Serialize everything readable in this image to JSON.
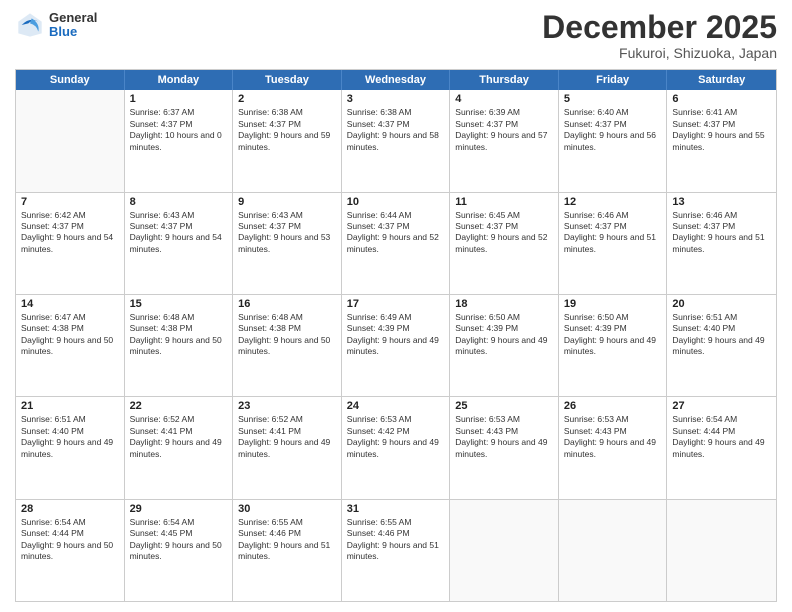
{
  "header": {
    "logo": {
      "general": "General",
      "blue": "Blue"
    },
    "title": "December 2025",
    "subtitle": "Fukuroi, Shizuoka, Japan"
  },
  "calendar": {
    "days": [
      "Sunday",
      "Monday",
      "Tuesday",
      "Wednesday",
      "Thursday",
      "Friday",
      "Saturday"
    ],
    "rows": [
      [
        {
          "day": "",
          "empty": true
        },
        {
          "day": "1",
          "sunrise": "Sunrise: 6:37 AM",
          "sunset": "Sunset: 4:37 PM",
          "daylight": "Daylight: 10 hours and 0 minutes."
        },
        {
          "day": "2",
          "sunrise": "Sunrise: 6:38 AM",
          "sunset": "Sunset: 4:37 PM",
          "daylight": "Daylight: 9 hours and 59 minutes."
        },
        {
          "day": "3",
          "sunrise": "Sunrise: 6:38 AM",
          "sunset": "Sunset: 4:37 PM",
          "daylight": "Daylight: 9 hours and 58 minutes."
        },
        {
          "day": "4",
          "sunrise": "Sunrise: 6:39 AM",
          "sunset": "Sunset: 4:37 PM",
          "daylight": "Daylight: 9 hours and 57 minutes."
        },
        {
          "day": "5",
          "sunrise": "Sunrise: 6:40 AM",
          "sunset": "Sunset: 4:37 PM",
          "daylight": "Daylight: 9 hours and 56 minutes."
        },
        {
          "day": "6",
          "sunrise": "Sunrise: 6:41 AM",
          "sunset": "Sunset: 4:37 PM",
          "daylight": "Daylight: 9 hours and 55 minutes."
        }
      ],
      [
        {
          "day": "7",
          "sunrise": "Sunrise: 6:42 AM",
          "sunset": "Sunset: 4:37 PM",
          "daylight": "Daylight: 9 hours and 54 minutes."
        },
        {
          "day": "8",
          "sunrise": "Sunrise: 6:43 AM",
          "sunset": "Sunset: 4:37 PM",
          "daylight": "Daylight: 9 hours and 54 minutes."
        },
        {
          "day": "9",
          "sunrise": "Sunrise: 6:43 AM",
          "sunset": "Sunset: 4:37 PM",
          "daylight": "Daylight: 9 hours and 53 minutes."
        },
        {
          "day": "10",
          "sunrise": "Sunrise: 6:44 AM",
          "sunset": "Sunset: 4:37 PM",
          "daylight": "Daylight: 9 hours and 52 minutes."
        },
        {
          "day": "11",
          "sunrise": "Sunrise: 6:45 AM",
          "sunset": "Sunset: 4:37 PM",
          "daylight": "Daylight: 9 hours and 52 minutes."
        },
        {
          "day": "12",
          "sunrise": "Sunrise: 6:46 AM",
          "sunset": "Sunset: 4:37 PM",
          "daylight": "Daylight: 9 hours and 51 minutes."
        },
        {
          "day": "13",
          "sunrise": "Sunrise: 6:46 AM",
          "sunset": "Sunset: 4:37 PM",
          "daylight": "Daylight: 9 hours and 51 minutes."
        }
      ],
      [
        {
          "day": "14",
          "sunrise": "Sunrise: 6:47 AM",
          "sunset": "Sunset: 4:38 PM",
          "daylight": "Daylight: 9 hours and 50 minutes."
        },
        {
          "day": "15",
          "sunrise": "Sunrise: 6:48 AM",
          "sunset": "Sunset: 4:38 PM",
          "daylight": "Daylight: 9 hours and 50 minutes."
        },
        {
          "day": "16",
          "sunrise": "Sunrise: 6:48 AM",
          "sunset": "Sunset: 4:38 PM",
          "daylight": "Daylight: 9 hours and 50 minutes."
        },
        {
          "day": "17",
          "sunrise": "Sunrise: 6:49 AM",
          "sunset": "Sunset: 4:39 PM",
          "daylight": "Daylight: 9 hours and 49 minutes."
        },
        {
          "day": "18",
          "sunrise": "Sunrise: 6:50 AM",
          "sunset": "Sunset: 4:39 PM",
          "daylight": "Daylight: 9 hours and 49 minutes."
        },
        {
          "day": "19",
          "sunrise": "Sunrise: 6:50 AM",
          "sunset": "Sunset: 4:39 PM",
          "daylight": "Daylight: 9 hours and 49 minutes."
        },
        {
          "day": "20",
          "sunrise": "Sunrise: 6:51 AM",
          "sunset": "Sunset: 4:40 PM",
          "daylight": "Daylight: 9 hours and 49 minutes."
        }
      ],
      [
        {
          "day": "21",
          "sunrise": "Sunrise: 6:51 AM",
          "sunset": "Sunset: 4:40 PM",
          "daylight": "Daylight: 9 hours and 49 minutes."
        },
        {
          "day": "22",
          "sunrise": "Sunrise: 6:52 AM",
          "sunset": "Sunset: 4:41 PM",
          "daylight": "Daylight: 9 hours and 49 minutes."
        },
        {
          "day": "23",
          "sunrise": "Sunrise: 6:52 AM",
          "sunset": "Sunset: 4:41 PM",
          "daylight": "Daylight: 9 hours and 49 minutes."
        },
        {
          "day": "24",
          "sunrise": "Sunrise: 6:53 AM",
          "sunset": "Sunset: 4:42 PM",
          "daylight": "Daylight: 9 hours and 49 minutes."
        },
        {
          "day": "25",
          "sunrise": "Sunrise: 6:53 AM",
          "sunset": "Sunset: 4:43 PM",
          "daylight": "Daylight: 9 hours and 49 minutes."
        },
        {
          "day": "26",
          "sunrise": "Sunrise: 6:53 AM",
          "sunset": "Sunset: 4:43 PM",
          "daylight": "Daylight: 9 hours and 49 minutes."
        },
        {
          "day": "27",
          "sunrise": "Sunrise: 6:54 AM",
          "sunset": "Sunset: 4:44 PM",
          "daylight": "Daylight: 9 hours and 49 minutes."
        }
      ],
      [
        {
          "day": "28",
          "sunrise": "Sunrise: 6:54 AM",
          "sunset": "Sunset: 4:44 PM",
          "daylight": "Daylight: 9 hours and 50 minutes."
        },
        {
          "day": "29",
          "sunrise": "Sunrise: 6:54 AM",
          "sunset": "Sunset: 4:45 PM",
          "daylight": "Daylight: 9 hours and 50 minutes."
        },
        {
          "day": "30",
          "sunrise": "Sunrise: 6:55 AM",
          "sunset": "Sunset: 4:46 PM",
          "daylight": "Daylight: 9 hours and 51 minutes."
        },
        {
          "day": "31",
          "sunrise": "Sunrise: 6:55 AM",
          "sunset": "Sunset: 4:46 PM",
          "daylight": "Daylight: 9 hours and 51 minutes."
        },
        {
          "day": "",
          "empty": true
        },
        {
          "day": "",
          "empty": true
        },
        {
          "day": "",
          "empty": true
        }
      ]
    ]
  }
}
